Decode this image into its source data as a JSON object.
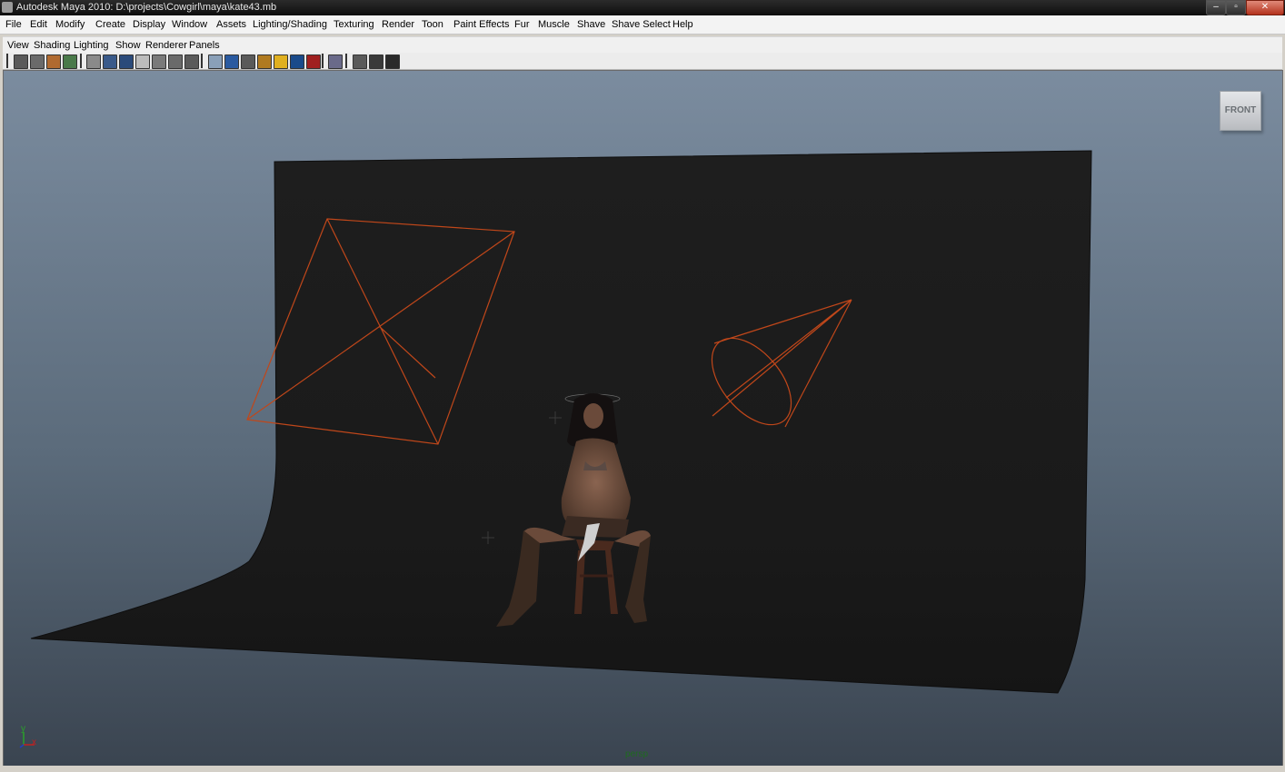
{
  "window": {
    "title": "Autodesk Maya 2010: D:\\projects\\Cowgirl\\maya\\kate43.mb",
    "min_glyph": "‒",
    "max_glyph": "▫",
    "close_glyph": "✕"
  },
  "menubar": [
    "File",
    "Edit",
    "Modify",
    "Create",
    "Display",
    "Window",
    "Assets",
    "Lighting/Shading",
    "Texturing",
    "Render",
    "Toon",
    "Paint Effects",
    "Fur",
    "Muscle",
    "Shave",
    "Shave Select",
    "Help"
  ],
  "panel_menu": [
    "View",
    "Shading",
    "Lighting",
    "Show",
    "Renderer",
    "Panels"
  ],
  "toolbar_icons": [
    {
      "name": "select-camera-icon",
      "color": "#5a5a5a"
    },
    {
      "name": "camera-attributes-icon",
      "color": "#6a6a6a"
    },
    {
      "name": "bookmark-icon",
      "color": "#b06a30"
    },
    {
      "name": "image-plane-icon",
      "color": "#4a7a4a"
    },
    {
      "name": "grid-icon",
      "color": "#8a8a8a"
    },
    {
      "name": "film-gate-icon",
      "color": "#3a5a8a"
    },
    {
      "name": "resolution-gate-icon",
      "color": "#2a4a7a"
    },
    {
      "name": "gate-mask-icon",
      "color": "#bcbcbc"
    },
    {
      "name": "field-chart-icon",
      "color": "#7a7a7a"
    },
    {
      "name": "safe-action-icon",
      "color": "#6a6a6a"
    },
    {
      "name": "safe-title-icon",
      "color": "#5a5a5a"
    },
    {
      "name": "wireframe-icon",
      "color": "#8aa0b8"
    },
    {
      "name": "smooth-shade-icon",
      "color": "#2a5aa0"
    },
    {
      "name": "flat-shade-icon",
      "color": "#5a5a5a"
    },
    {
      "name": "texture-icon",
      "color": "#b07a20"
    },
    {
      "name": "lights-icon",
      "color": "#e0b020"
    },
    {
      "name": "shadows-icon",
      "color": "#1a4a8a"
    },
    {
      "name": "xray-icon",
      "color": "#a02020"
    },
    {
      "name": "isolate-select-icon",
      "color": "#6a6a8a"
    },
    {
      "name": "hud-icon",
      "color": "#5a5a5a"
    },
    {
      "name": "render-view-icon",
      "color": "#3a3a3a"
    },
    {
      "name": "ipr-render-icon",
      "color": "#2a2a2a"
    }
  ],
  "viewport": {
    "viewcube_label": "FRONT",
    "camera_label": "persp",
    "axis_y": "y",
    "axis_x": "x",
    "bg_top": "#7b8c9f",
    "bg_bottom": "#3a4450",
    "light_color": "#c0471a"
  }
}
